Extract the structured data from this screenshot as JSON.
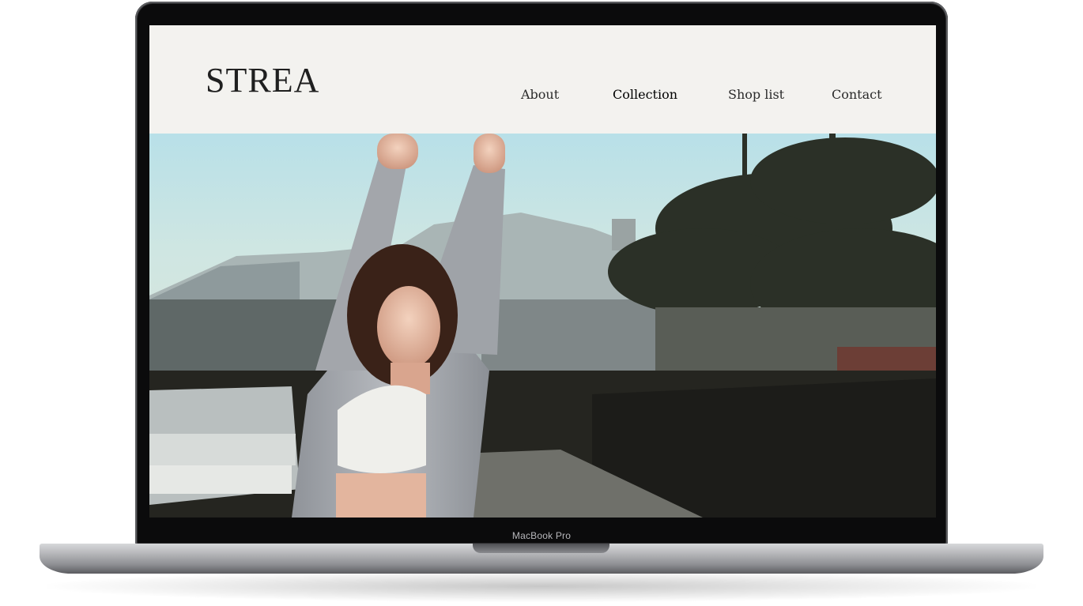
{
  "device": {
    "label": "MacBook Pro"
  },
  "site": {
    "logo": "STREA",
    "nav": [
      {
        "label": "About"
      },
      {
        "label": "Collection"
      },
      {
        "label": "Shop list"
      },
      {
        "label": "Contact"
      }
    ]
  },
  "colors": {
    "header_bg": "#f3f2ef",
    "text": "#1f1f1f"
  }
}
